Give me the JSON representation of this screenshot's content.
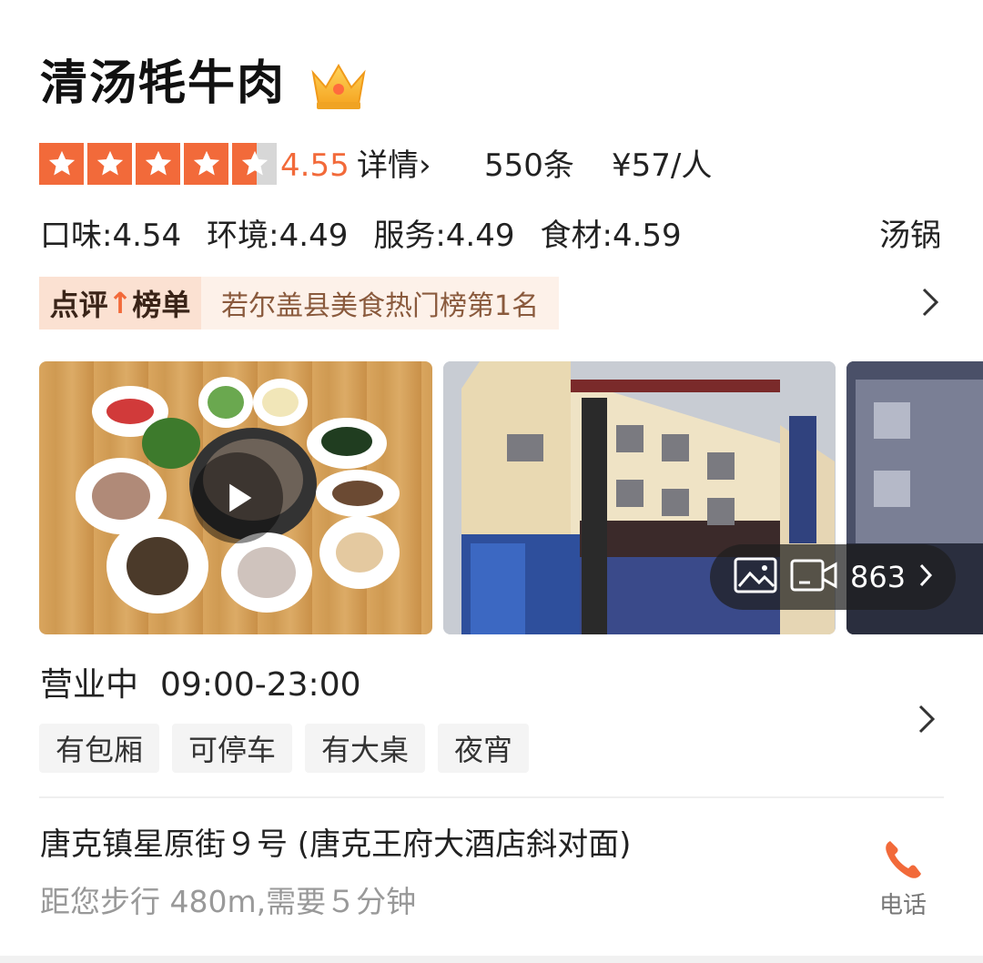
{
  "shop": {
    "name": "清汤牦牛肉",
    "badge_icon": "crown-icon"
  },
  "rating": {
    "stars_value": 4.55,
    "score": "4.55",
    "detail_label": "详情",
    "detail_chevron": "›",
    "reviews": "550条",
    "price": "¥57/人",
    "star_color": "#f26a3a"
  },
  "sub_scores": [
    {
      "label": "口味:4.54"
    },
    {
      "label": "环境:4.49"
    },
    {
      "label": "服务:4.49"
    },
    {
      "label": "食材:4.59"
    }
  ],
  "category": "汤锅",
  "ranking": {
    "tag_before": "点评",
    "tag_arrow": "↑",
    "tag_after": "榜单",
    "text": "若尔盖县美食热门榜第1名"
  },
  "media": {
    "count": "863",
    "photo_icon": "image-icon",
    "video_icon": "video-icon"
  },
  "hours": {
    "status": "营业中",
    "time": "09:00-23:00"
  },
  "tags": [
    "有包厢",
    "可停车",
    "有大桌",
    "夜宵"
  ],
  "address": {
    "line": "唐克镇星原街９号 (唐克王府大酒店斜对面)",
    "distance": "距您步行 480m,需要５分钟"
  },
  "phone": {
    "label": "电话",
    "icon": "phone-icon"
  }
}
